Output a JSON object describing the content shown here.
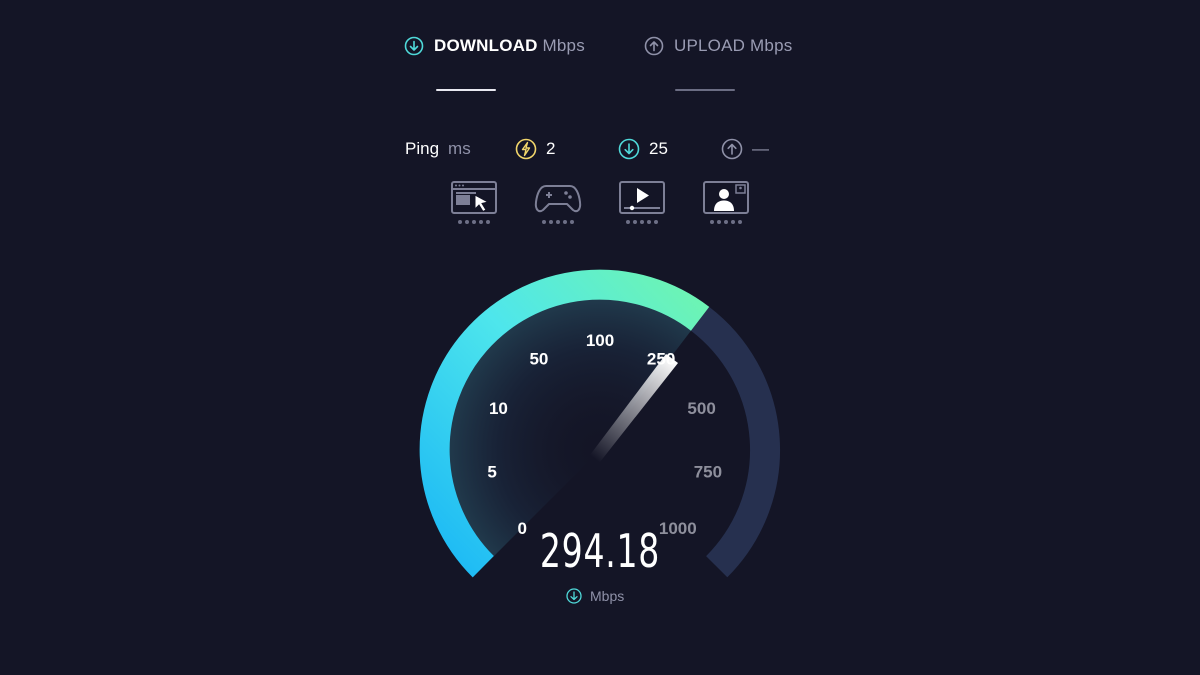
{
  "tabs": {
    "download": {
      "title": "DOWNLOAD",
      "unit": "Mbps",
      "icon": "download-arrow-icon",
      "active": true
    },
    "upload": {
      "title": "UPLOAD",
      "unit": "Mbps",
      "icon": "upload-arrow-icon",
      "active": false
    }
  },
  "ping": {
    "label": "Ping",
    "unit": "ms",
    "idle": {
      "icon": "lightning-icon",
      "value": "2"
    },
    "download": {
      "icon": "download-arrow-icon",
      "value": "25"
    },
    "upload": {
      "icon": "upload-arrow-icon",
      "value": "—"
    }
  },
  "activities": [
    {
      "icon": "web-browsing-icon",
      "rating": 5
    },
    {
      "icon": "gaming-controller-icon",
      "rating": 5
    },
    {
      "icon": "video-streaming-icon",
      "rating": 5
    },
    {
      "icon": "video-call-icon",
      "rating": 5
    }
  ],
  "gauge": {
    "scale_labels": [
      "0",
      "5",
      "10",
      "50",
      "100",
      "250",
      "500",
      "750",
      "1000"
    ],
    "current_value": "294.18",
    "unit": "Mbps",
    "unit_icon": "download-arrow-icon",
    "colors": {
      "active_start": "#1ab7f5",
      "active_mid": "#4ee6ec",
      "active_end": "#6ff5b0",
      "inactive": "#26304f",
      "active_label": "#ffffff",
      "inactive_label": "#8e8f9c"
    }
  }
}
